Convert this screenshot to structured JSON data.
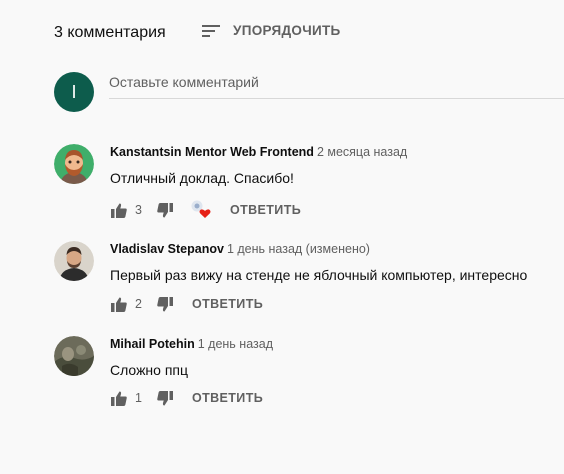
{
  "header": {
    "count": "3 комментария",
    "sort_label": "УПОРЯДОЧИТЬ"
  },
  "composer": {
    "avatar_letter": "I",
    "avatar_color": "#0d5c4c",
    "placeholder": "Оставьте комментарий"
  },
  "comments": [
    {
      "author": "Kanstantsin Mentor Web Frontend",
      "time": "2 месяца назад",
      "text": "Отличный доклад. Спасибо!",
      "likes": "3",
      "hearted": true,
      "reply_label": "ОТВЕТИТЬ"
    },
    {
      "author": "Vladislav Stepanov",
      "time": "1 день назад (изменено)",
      "text": "Первый раз вижу на стенде не яблочный компьютер, интересно",
      "likes": "2",
      "hearted": false,
      "reply_label": "ОТВЕТИТЬ"
    },
    {
      "author": "Mihail Potehin",
      "time": "1 день назад",
      "text": "Сложно ппц",
      "likes": "1",
      "hearted": false,
      "reply_label": "ОТВЕТИТЬ"
    }
  ],
  "colors": {
    "heart": "#e62117",
    "secondary_text": "#606060"
  }
}
